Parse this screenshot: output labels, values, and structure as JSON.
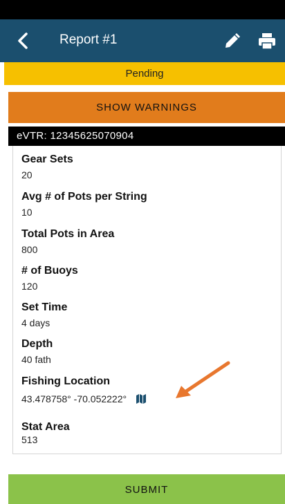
{
  "app_bar": {
    "title": "Report #1",
    "back_icon": "chevron-left-icon",
    "edit_icon": "pencil-icon",
    "print_icon": "printer-icon",
    "color": "#1b4f6e"
  },
  "status": {
    "label": "Pending",
    "color": "#f6c000"
  },
  "warnings_button": {
    "label": "SHOW WARNINGS",
    "color": "#e17c1c"
  },
  "evtr": {
    "label": "eVTR: 12345625070904"
  },
  "fields": [
    {
      "label": "Gear Sets",
      "value": "20"
    },
    {
      "label": "Avg # of Pots per String",
      "value": "10"
    },
    {
      "label": "Total Pots in Area",
      "value": "800"
    },
    {
      "label": "# of Buoys",
      "value": "120"
    },
    {
      "label": "Set Time",
      "value": "4 days"
    },
    {
      "label": "Depth",
      "value": "40 fath"
    },
    {
      "label": "Fishing Location",
      "value": "43.478758° -70.052222°",
      "icon": "map-icon"
    },
    {
      "label": "Stat Area",
      "value": "513"
    }
  ],
  "annotation": {
    "type": "arrow",
    "color": "#e8772e"
  },
  "submit_button": {
    "label": "SUBMIT",
    "color": "#8bc24a"
  }
}
